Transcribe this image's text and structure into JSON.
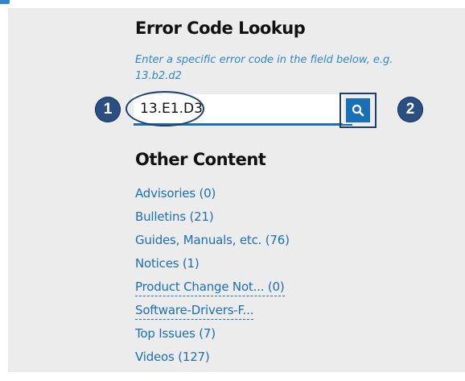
{
  "lookup": {
    "title": "Error Code Lookup",
    "hint": "Enter a specific error code in the field below, e.g. 13.b2.d2",
    "input_value": "13.E1.D3",
    "search_icon": "search-icon",
    "callout_1": "1",
    "callout_2": "2"
  },
  "other_content": {
    "title": "Other Content",
    "items": [
      {
        "label": "Advisories (0)"
      },
      {
        "label": "Bulletins (21)"
      },
      {
        "label": "Guides, Manuals, etc. (76)"
      },
      {
        "label": "Notices (1)"
      },
      {
        "label": "Product Change Not... (0)"
      },
      {
        "label": "Software-Drivers-F..."
      },
      {
        "label": "Top Issues (7)"
      },
      {
        "label": "Videos (127)"
      }
    ]
  },
  "colors": {
    "link": "#1b6fb5",
    "panel_background": "#ececec",
    "callout": "#2b4f80",
    "hint": "#2f86c8"
  }
}
